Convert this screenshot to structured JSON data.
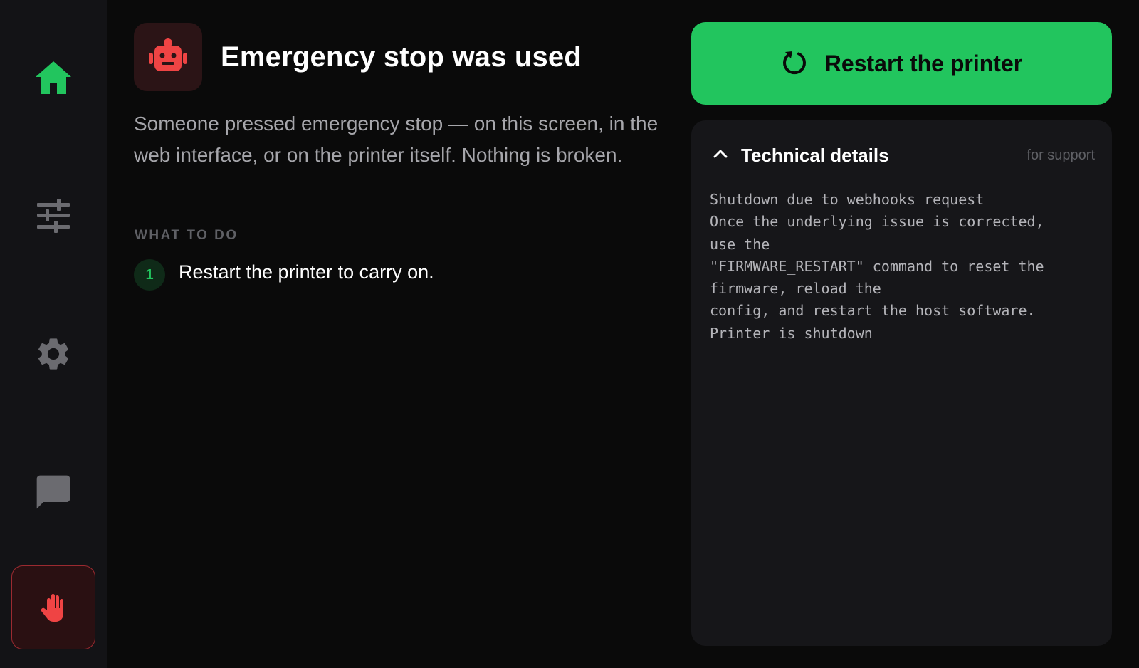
{
  "colors": {
    "accent_green": "#22c55e",
    "danger_red": "#ef4444",
    "background": "#0a0a0a",
    "sidebar": "#131316",
    "panel": "#161619",
    "muted_text": "#a6a6ab",
    "dim_text": "#5f6065"
  },
  "sidebar": {
    "items": [
      {
        "icon": "home-icon",
        "active": true
      },
      {
        "icon": "sliders-icon",
        "active": false
      },
      {
        "icon": "gear-icon",
        "active": false
      },
      {
        "icon": "chat-icon",
        "active": false
      },
      {
        "icon": "hand-stop-icon",
        "active": false
      }
    ]
  },
  "error": {
    "icon": "robot-icon",
    "title": "Emergency stop was used",
    "description": "Someone pressed emergency stop — on this screen, in the web interface, or on the printer itself. Nothing is broken.",
    "section_label": "WHAT TO DO",
    "steps": [
      {
        "number": "1",
        "text": "Restart the printer to carry on."
      }
    ]
  },
  "actions": {
    "restart_label": "Restart the printer"
  },
  "details": {
    "title": "Technical details",
    "hint": "for support",
    "expanded": true,
    "lines": [
      "Shutdown due to webhooks request",
      "Once the underlying issue is corrected,",
      "use the",
      "\"FIRMWARE_RESTART\" command to reset the",
      "firmware, reload the",
      "config, and restart the host software.",
      "Printer is shutdown"
    ]
  }
}
